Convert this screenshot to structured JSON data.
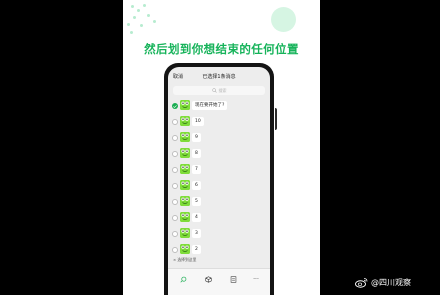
{
  "headline": "然后划到你想结束的任何位置",
  "chat": {
    "cancel_label": "取消",
    "title": "已选择1条消息",
    "search_placeholder": "搜索",
    "messages": [
      {
        "text": "现在要开始了?",
        "selected": true
      },
      {
        "text": "10",
        "selected": false
      },
      {
        "text": "9",
        "selected": false
      },
      {
        "text": "8",
        "selected": false
      },
      {
        "text": "7",
        "selected": false
      },
      {
        "text": "6",
        "selected": false
      },
      {
        "text": "5",
        "selected": false
      },
      {
        "text": "4",
        "selected": false
      },
      {
        "text": "3",
        "selected": false
      },
      {
        "text": "2",
        "selected": false
      }
    ],
    "selection_note": "× 选择到这里",
    "toolbar_more": "···"
  },
  "watermark": "@四川观察",
  "colors": {
    "accent": "#16b35a",
    "check": "#1aad52",
    "avatar": "#7fdc3a"
  }
}
